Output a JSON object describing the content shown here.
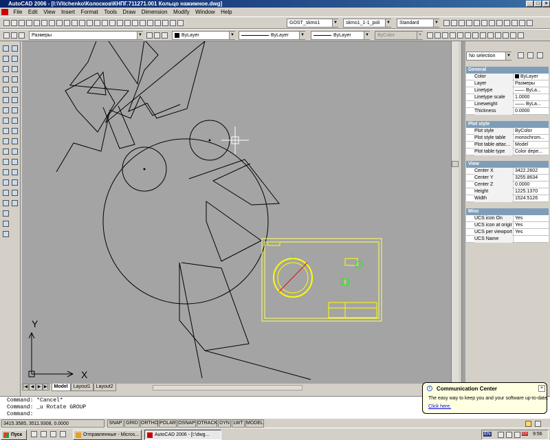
{
  "window": {
    "title": "AutoCAD 2006 - [I:\\Vitchenko\\Колосков\\КНПГ.711271.001 Кольцо нажимное.dwg]"
  },
  "menu": [
    "File",
    "Edit",
    "View",
    "Insert",
    "Format",
    "Tools",
    "Draw",
    "Dimension",
    "Modify",
    "Window",
    "Help"
  ],
  "toolbar": {
    "text_style": "GOST_skmo1",
    "dim_style": "skmo1_1-1_poli",
    "table_style": "Standard",
    "layer": "Размеры",
    "color": "ByLayer",
    "linetype": "ByLayer",
    "lineweight": "ByLayer",
    "plotstyle": "ByColor"
  },
  "tabs": [
    "Model",
    "Layout1",
    "Layout2"
  ],
  "properties": {
    "selection": "No selection",
    "general_title": "General",
    "general": [
      {
        "k": "Color",
        "v": "ByLayer"
      },
      {
        "k": "Layer",
        "v": "Размеры"
      },
      {
        "k": "Linetype",
        "v": "—— ByLa..."
      },
      {
        "k": "Linetype scale",
        "v": "1.0000"
      },
      {
        "k": "Lineweight",
        "v": "—— ByLa..."
      },
      {
        "k": "Thickness",
        "v": "0.0000"
      }
    ],
    "plot_title": "Plot style",
    "plot": [
      {
        "k": "Plot style",
        "v": "ByColor"
      },
      {
        "k": "Plot style table",
        "v": "monochrom..."
      },
      {
        "k": "Plot table attac...",
        "v": "Model"
      },
      {
        "k": "Plot table type",
        "v": "Color depe..."
      }
    ],
    "view_title": "View",
    "view": [
      {
        "k": "Center X",
        "v": "3422.2602"
      },
      {
        "k": "Center Y",
        "v": "3255.8634"
      },
      {
        "k": "Center Z",
        "v": "0.0000"
      },
      {
        "k": "Height",
        "v": "1225.1370"
      },
      {
        "k": "Width",
        "v": "1524.5126"
      }
    ],
    "misc_title": "Misc",
    "misc": [
      {
        "k": "UCS icon On",
        "v": "Yes"
      },
      {
        "k": "UCS icon at origin",
        "v": "Yes"
      },
      {
        "k": "UCS per viewport",
        "v": "Yes"
      },
      {
        "k": "UCS Name",
        "v": ""
      }
    ]
  },
  "command": {
    "line1": "Command: *Cancel*",
    "line2": "Command: _u Rotate GROUP",
    "line3": "Command:"
  },
  "status": {
    "coords": "3415.3585, 3511.9308, 0.0000",
    "buttons": [
      "SNAP",
      "GRID",
      "ORTHO",
      "POLAR",
      "OSNAP",
      "OTRACK",
      "DYN",
      "LWT",
      "MODEL"
    ]
  },
  "ucs": {
    "x": "X",
    "y": "Y"
  },
  "balloon": {
    "title": "Communication Center",
    "text": "The easy way to keep you and your software up-to-date.",
    "link": "Click here."
  },
  "taskbar": {
    "start": "Пуск",
    "items": [
      "Отправленные - Micros...",
      "AutoCAD 2006 - [I:\\dwg..."
    ],
    "lang": "EN",
    "lang2": "En",
    "time": "9:56"
  },
  "colors": {
    "canvas": "#a4a4a4",
    "accent": "#0a246a",
    "section": "#7f9db9"
  }
}
